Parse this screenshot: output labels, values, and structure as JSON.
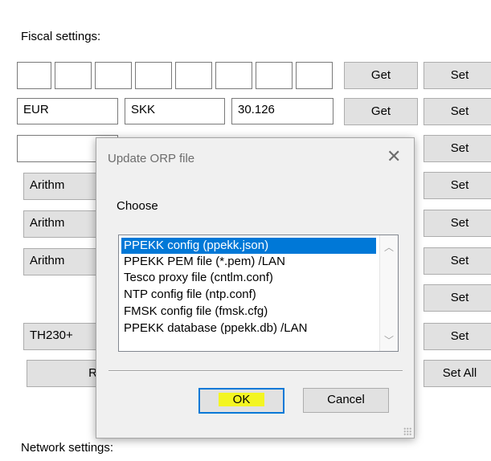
{
  "fiscal": {
    "section_label": "Fiscal settings:",
    "row_currency": {
      "from": "EUR",
      "to": "SKK",
      "rate": "30.126"
    },
    "combo_value": "Arithm",
    "printer_value": "TH230+",
    "read_label": "Read",
    "get_label": "Get",
    "set_label": "Set",
    "set_all_label": "Set All"
  },
  "network": {
    "section_label": "Network settings:"
  },
  "dialog": {
    "title": "Update ORP file",
    "close_glyph": "✕",
    "prompt": "Choose",
    "options": [
      "PPEKK config (ppekk.json)",
      "PPEKK PEM file (*.pem) /LAN",
      "Tesco proxy file (cntlm.conf)",
      "NTP config file (ntp.conf)",
      "FMSK config file (fmsk.cfg)",
      "PPEKK database (ppekk.db) /LAN"
    ],
    "selected_index": 0,
    "ok_label": "OK",
    "cancel_label": "Cancel",
    "ok_highlight_color": "#f3f522"
  },
  "colors": {
    "selection": "#0078d7",
    "button_bg": "#e1e1e1"
  }
}
